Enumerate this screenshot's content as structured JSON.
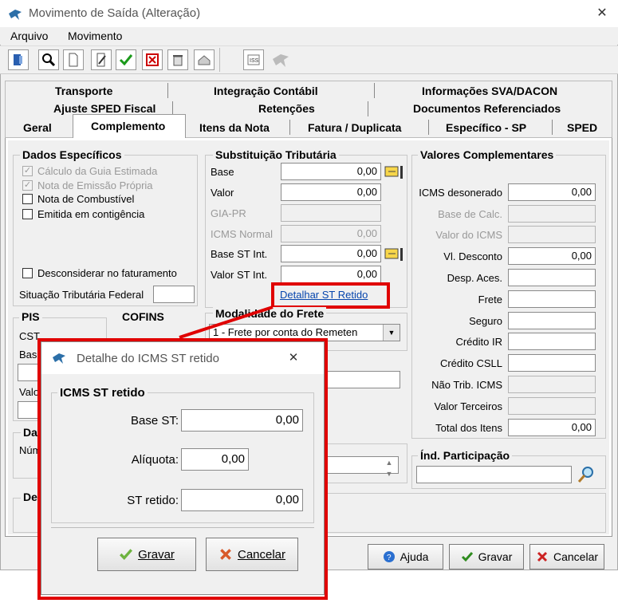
{
  "window": {
    "title": "Movimento de Saída (Alteração)"
  },
  "menu": [
    "Arquivo",
    "Movimento"
  ],
  "tabs": {
    "row1": [
      "Transporte",
      "Integração Contábil",
      "Informações SVA/DACON"
    ],
    "row2": [
      "Ajuste SPED Fiscal",
      "Retenções",
      "Documentos Referenciados"
    ],
    "row3": [
      "Geral",
      "Complemento",
      "Itens da Nota",
      "Fatura / Duplicata",
      "Específico - SP",
      "SPED"
    ],
    "active": "Complemento"
  },
  "dados_especificos": {
    "legend": "Dados Específicos",
    "checks": [
      {
        "label": "Cálculo da Guia Estimada",
        "checked": true,
        "disabled": true
      },
      {
        "label": "Nota de Emissão Própria",
        "checked": true,
        "disabled": true
      },
      {
        "label": "Nota de Combustível",
        "checked": false,
        "disabled": false
      },
      {
        "label": "Emitida em contigência",
        "checked": false,
        "disabled": false
      }
    ],
    "desconsiderar": "Desconsiderar no faturamento",
    "situacao": "Situação Tributária Federal"
  },
  "st": {
    "legend": "Substituição Tributária",
    "rows": [
      {
        "label": "Base",
        "value": "0,00"
      },
      {
        "label": "Valor",
        "value": "0,00"
      },
      {
        "label": "GIA-PR",
        "value": ""
      },
      {
        "label": "ICMS Normal",
        "value": "0,00"
      },
      {
        "label": "Base ST Int.",
        "value": "0,00"
      },
      {
        "label": "Valor ST Int.",
        "value": "0,00"
      }
    ],
    "link": "Detalhar ST Retido"
  },
  "modalidade": {
    "legend": "Modalidade do Frete",
    "value": "1 - Frete por conta do Remeten"
  },
  "valores": {
    "legend": "Valores Complementares",
    "rows": [
      {
        "label": "ICMS desonerado",
        "value": "0,00"
      },
      {
        "label": "Base de Calc.",
        "value": ""
      },
      {
        "label": "Valor do ICMS",
        "value": ""
      },
      {
        "label": "Vl. Desconto",
        "value": "0,00"
      },
      {
        "label": "Desp. Aces.",
        "value": ""
      },
      {
        "label": "Frete",
        "value": ""
      },
      {
        "label": "Seguro",
        "value": ""
      },
      {
        "label": "Crédito IR",
        "value": ""
      },
      {
        "label": "Crédito CSLL",
        "value": ""
      },
      {
        "label": "Não Trib. ICMS",
        "value": ""
      },
      {
        "label": "Valor Terceiros",
        "value": ""
      },
      {
        "label": "Total dos Itens",
        "value": "0,00"
      }
    ]
  },
  "ind_participacao": {
    "legend": "Índ. Participação"
  },
  "partial": {
    "pis": "PIS",
    "cofins": "COFINS",
    "cst": "CST",
    "bas": "Bas",
    "val": "Valo",
    "da": "Da",
    "num": "Núm",
    "de": "De"
  },
  "footer": {
    "ajuda": "Ajuda",
    "gravar": "Gravar",
    "cancelar": "Cancelar"
  },
  "dialog": {
    "title": "Detalhe do ICMS ST retido",
    "legend": "ICMS ST retido",
    "base_label": "Base ST:",
    "base_value": "0,00",
    "aliquota_label": "Alíquota:",
    "aliquota_value": "0,00",
    "retido_label": "ST retido:",
    "retido_value": "0,00",
    "gravar": "Gravar",
    "cancelar": "Cancelar"
  },
  "colors": {
    "highlight": "#e00000",
    "link": "#0645ad",
    "ok": "#2e8b1e",
    "cancel": "#cc2222"
  }
}
